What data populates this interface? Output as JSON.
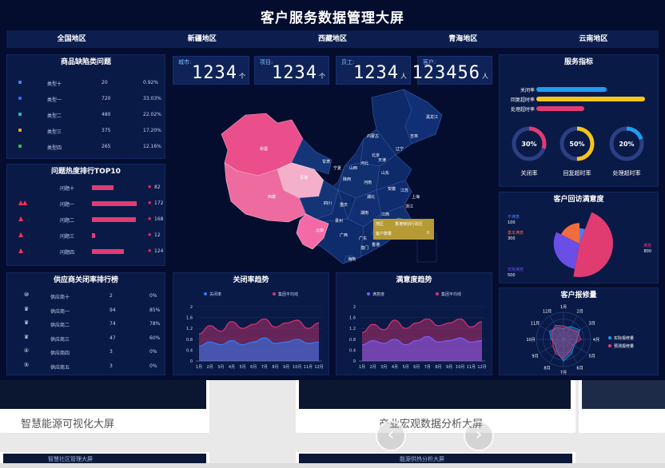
{
  "title": "客户服务数据管理大屏",
  "regions": [
    "全国地区",
    "新疆地区",
    "西藏地区",
    "青海地区",
    "云南地区"
  ],
  "colors": {
    "background": "#040d2e",
    "panel": "#0a1a47",
    "accent_pink": "#e03c72",
    "accent_blue": "#1e9cf0",
    "accent_yellow": "#f5c518"
  },
  "defects": {
    "title": "商品缺陷类问题",
    "rows": [
      {
        "name": "类型十",
        "count": "20",
        "pct": "0.92%",
        "color": "#4f7cff"
      },
      {
        "name": "类型一",
        "count": "720",
        "pct": "33.03%",
        "color": "#2a6cf5"
      },
      {
        "name": "类型二",
        "count": "480",
        "pct": "22.02%",
        "color": "#20c3c4"
      },
      {
        "name": "类型三",
        "count": "375",
        "pct": "17.20%",
        "color": "#f5a623"
      },
      {
        "name": "类型四",
        "count": "265",
        "pct": "12.16%",
        "color": "#33c24b"
      }
    ]
  },
  "hot": {
    "title": "问题热度排行TOP10",
    "rows": [
      {
        "flames": "🔥",
        "name": "问题十",
        "value": 82,
        "label": "82"
      },
      {
        "flames": "🔥🔥🔥🔥",
        "name": "问题一",
        "value": 172,
        "label": "172"
      },
      {
        "flames": "🔥🔥🔥",
        "name": "问题二",
        "value": 168,
        "label": "168"
      },
      {
        "flames": "🔥🔥",
        "name": "问题三",
        "value": 12,
        "label": "12"
      },
      {
        "flames": "🔥🔥🔥",
        "name": "问题四",
        "value": 124,
        "label": "124"
      }
    ]
  },
  "suppliers": {
    "title": "供应商关闭率排行榜",
    "rows": [
      {
        "icon": "⑩",
        "name": "供应商十",
        "value": "2",
        "pct": "0%"
      },
      {
        "icon": "♛",
        "name": "供应商一",
        "value": "94",
        "pct": "85%"
      },
      {
        "icon": "♛",
        "name": "供应商二",
        "value": "74",
        "pct": "78%"
      },
      {
        "icon": "♛",
        "name": "供应商三",
        "value": "47",
        "pct": "60%"
      },
      {
        "icon": "④",
        "name": "供应商四",
        "value": "3",
        "pct": "0%"
      },
      {
        "icon": "⑤",
        "name": "供应商五",
        "value": "3",
        "pct": "0%"
      }
    ]
  },
  "stats": [
    {
      "label": "城市:",
      "value": "1234",
      "unit": "个"
    },
    {
      "label": "项目:",
      "value": "1234",
      "unit": "个"
    },
    {
      "label": "员工:",
      "value": "1234",
      "unit": "人"
    },
    {
      "label": "客户:",
      "value": "123456",
      "unit": "人"
    }
  ],
  "map": {
    "labels": [
      "黑龙江",
      "吉林",
      "辽宁",
      "内蒙古",
      "北京",
      "天津",
      "河北",
      "山西",
      "山东",
      "河南",
      "陕西",
      "宁夏",
      "甘肃",
      "新疆",
      "青海",
      "西藏",
      "四川",
      "重庆",
      "湖北",
      "安徽",
      "江苏",
      "上海",
      "浙江",
      "江西",
      "湖南",
      "贵州",
      "云南",
      "广西",
      "广东",
      "福建",
      "台湾",
      "海南",
      "香港",
      "澳门"
    ],
    "tooltip": {
      "region_label": "地区",
      "region_value": "香港特别行政区",
      "count_label": "客户数量",
      "count_value": "0"
    }
  },
  "trend_close": {
    "title": "关闭率趋势",
    "legend": [
      "关闭率",
      "集团平均线"
    ]
  },
  "trend_satisfaction": {
    "title": "满意度趋势",
    "legend": [
      "满意度",
      "集团平均线"
    ]
  },
  "service": {
    "title": "服务指标",
    "bars": [
      {
        "label": "关闭率",
        "value": 0.62,
        "color": "#1e9cf0"
      },
      {
        "label": "回复超时率",
        "value": 0.96,
        "color": "#f5c518"
      },
      {
        "label": "处理超时率",
        "value": 0.42,
        "color": "#e03c72"
      }
    ],
    "gauges": [
      {
        "label": "关闭率",
        "text": "30%",
        "value": 0.3,
        "color": "#e03c72"
      },
      {
        "label": "回复超时率",
        "text": "50%",
        "value": 0.5,
        "color": "#f5c518"
      },
      {
        "label": "处理超时率",
        "text": "20%",
        "value": 0.2,
        "color": "#1e9cf0"
      }
    ]
  },
  "satisfaction": {
    "title": "客户回访满意度",
    "labels": [
      {
        "name": "不满意",
        "value": "100",
        "color": "#4f7cff"
      },
      {
        "name": "基本满意",
        "value": "300",
        "color": "#f26d3d"
      },
      {
        "name": "非常满意",
        "value": "500",
        "color": "#6b4ee6"
      },
      {
        "name": "满意",
        "value": "800",
        "color": "#e03c72"
      }
    ]
  },
  "visits": {
    "title": "客户报修量",
    "legend": [
      "实际报修量",
      "预测报修量"
    ]
  },
  "chart_data": [
    {
      "type": "area",
      "title": "关闭率趋势",
      "categories": [
        "1月",
        "2月",
        "3月",
        "4月",
        "5月",
        "6月",
        "7月",
        "8月",
        "9月",
        "10月",
        "11月",
        "12月"
      ],
      "ylim": [
        0,
        2
      ],
      "yticks": [
        "0",
        "0.4",
        "0.8",
        "1.2",
        "1.6",
        "2"
      ],
      "series": [
        {
          "name": "关闭率",
          "values": [
            0.55,
            0.7,
            0.6,
            0.75,
            0.6,
            0.7,
            0.85,
            0.65,
            0.7,
            0.8,
            0.65,
            0.7
          ]
        },
        {
          "name": "集团平均线",
          "values": [
            1.0,
            1.3,
            1.1,
            1.45,
            1.2,
            1.35,
            1.55,
            1.25,
            1.4,
            1.5,
            1.2,
            1.4
          ]
        }
      ]
    },
    {
      "type": "area",
      "title": "满意度趋势",
      "categories": [
        "1月",
        "2月",
        "3月",
        "4月",
        "5月",
        "6月",
        "7月",
        "8月",
        "9月",
        "10月",
        "11月",
        "12月"
      ],
      "ylim": [
        0,
        2
      ],
      "yticks": [
        "0",
        "0.4",
        "0.8",
        "1.2",
        "1.6",
        "2"
      ],
      "series": [
        {
          "name": "满意度",
          "values": [
            0.6,
            0.75,
            0.65,
            0.8,
            0.6,
            0.75,
            0.9,
            0.7,
            0.75,
            0.85,
            0.7,
            0.75
          ]
        },
        {
          "name": "集团平均线",
          "values": [
            1.05,
            1.35,
            1.15,
            1.5,
            1.2,
            1.4,
            1.55,
            1.3,
            1.4,
            1.55,
            1.25,
            1.45
          ]
        }
      ]
    },
    {
      "type": "pie",
      "title": "客户回访满意度",
      "categories": [
        "不满意",
        "基本满意",
        "非常满意",
        "满意"
      ],
      "values": [
        100,
        300,
        500,
        800
      ]
    },
    {
      "type": "radar",
      "title": "客户报修量",
      "categories": [
        "1月",
        "2月",
        "3月",
        "4月",
        "5月",
        "6月",
        "7月",
        "8月",
        "9月",
        "10月",
        "11月",
        "12月"
      ],
      "series": [
        {
          "name": "实际报修量",
          "values": [
            0.4,
            0.55,
            0.7,
            0.5,
            0.45,
            0.6,
            0.8,
            0.5,
            0.35,
            0.45,
            0.6,
            0.5
          ]
        },
        {
          "name": "预测报修量",
          "values": [
            0.5,
            0.45,
            0.6,
            0.65,
            0.4,
            0.5,
            0.7,
            0.6,
            0.45,
            0.4,
            0.5,
            0.6
          ]
        }
      ]
    }
  ]
}
